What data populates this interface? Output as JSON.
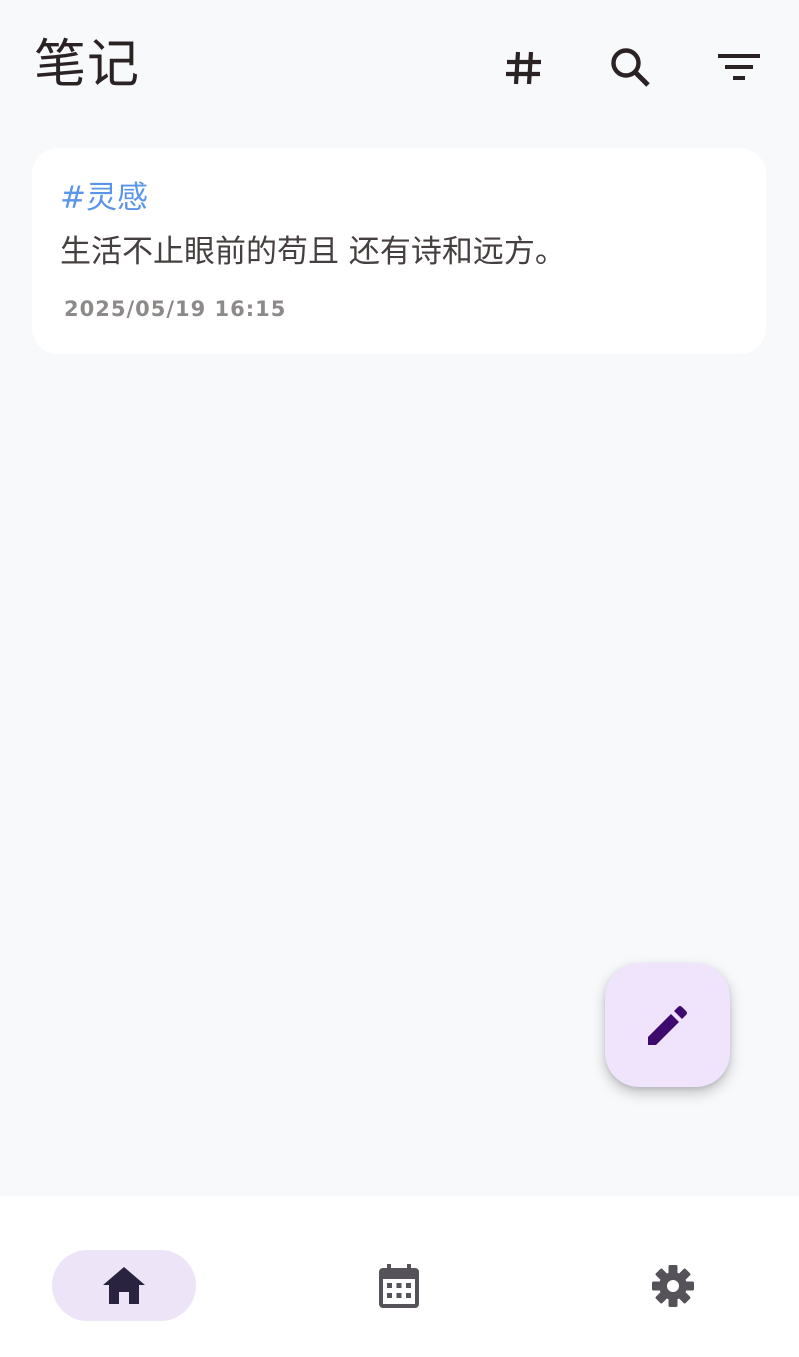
{
  "header": {
    "title": "笔记",
    "icons": [
      "hashtag-icon",
      "search-icon",
      "filter-icon"
    ]
  },
  "notes": [
    {
      "tag": "#灵感",
      "text": "生活不止眼前的苟且 还有诗和远方。",
      "time": "2025/05/19 16:15"
    }
  ],
  "fab": {
    "icon": "pencil-icon"
  },
  "bottom_nav": {
    "items": [
      {
        "icon": "home-icon",
        "selected": true
      },
      {
        "icon": "calendar-icon",
        "selected": false
      },
      {
        "icon": "gear-icon",
        "selected": false
      }
    ]
  },
  "colors": {
    "background": "#f8f9fb",
    "card": "#ffffff",
    "tag": "#5b95e8",
    "accent_container": "#efe4fb",
    "accent_icon": "#3f0a6e",
    "nav_indicator": "#ede4f8"
  }
}
